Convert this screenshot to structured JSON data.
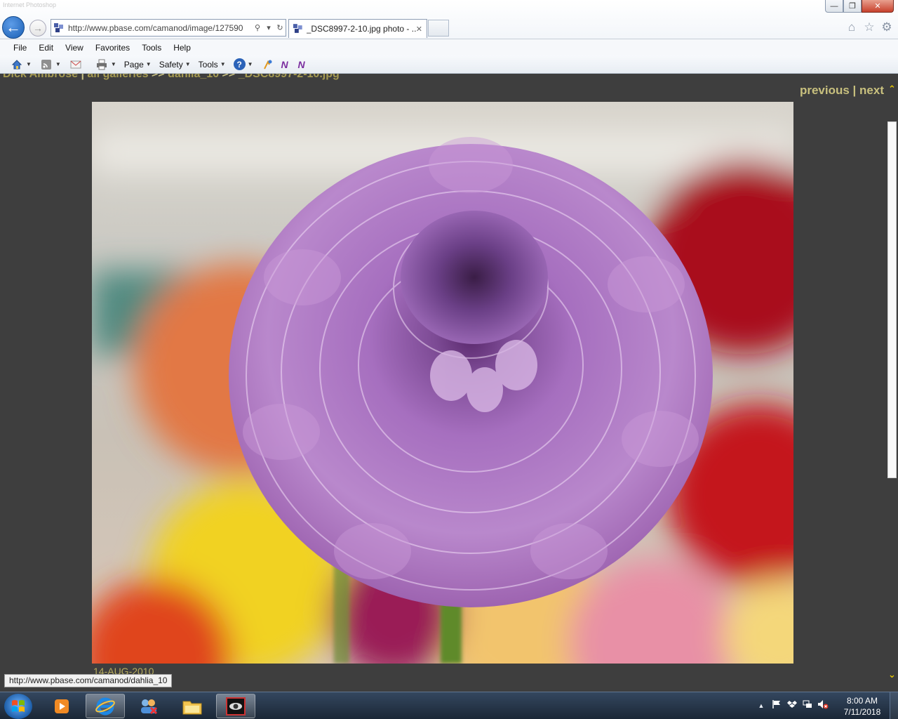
{
  "window": {
    "faint_title": "Internet Photoshop",
    "controls": {
      "minimize": "—",
      "maximize": "❐",
      "close": "✕"
    }
  },
  "nav": {
    "back_glyph": "←",
    "forward_glyph": "→"
  },
  "address": {
    "url": "http://www.pbase.com/camanod/image/127590",
    "search_glyph": "⚲",
    "dropdown_glyph": "▾",
    "refresh_glyph": "↻"
  },
  "tab": {
    "label": "_DSC8997-2-10.jpg photo - ...",
    "close_glyph": "✕"
  },
  "right_icons": {
    "home": "⌂",
    "favorites": "☆",
    "tools": "⚙"
  },
  "menu": [
    "File",
    "Edit",
    "View",
    "Favorites",
    "Tools",
    "Help"
  ],
  "commandbar": {
    "page_label": "Page",
    "safety_label": "Safety",
    "tools_label": "Tools",
    "help_glyph": "?",
    "onenote_glyph": "N"
  },
  "page": {
    "breadcrumb": {
      "owner": "Dick Ambrose",
      "separator": "|",
      "galleries": "all galleries",
      "arrow1": ">>",
      "gallery": "dahlia_10",
      "arrow2": ">>",
      "image": "_DSC8997-2-10.jpg"
    },
    "nav_previous": "previous",
    "nav_separator": "|",
    "nav_next": "next",
    "photo_date": "14-AUG-2010"
  },
  "scrollbar": {
    "up": "⌃",
    "down": "⌄"
  },
  "status_url": "http://www.pbase.com/camanod/dahlia_10",
  "taskbar": {
    "tray_arrow": "▲",
    "clock_time": "8:00 AM",
    "clock_date": "7/11/2018"
  },
  "colors": {
    "page_background": "#3e3e3e",
    "link_color": "#c8c07e",
    "scroll_arrow": "#e8c800",
    "dahlia_petal": "#b57ec8"
  }
}
